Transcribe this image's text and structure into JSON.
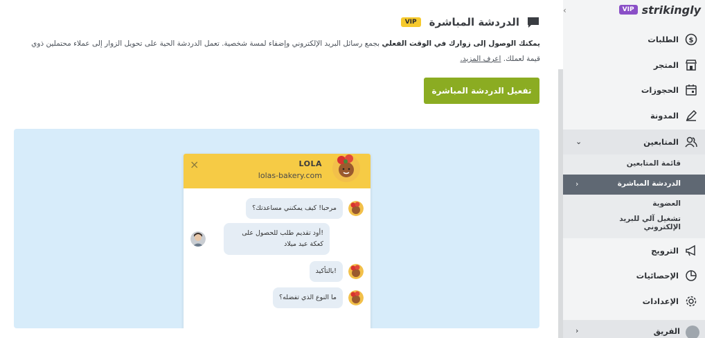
{
  "main": {
    "title": "الدردشة المباشرة",
    "vip_badge": "VIP",
    "description_bold": "يمكنك الوصول إلى زوارك في الوقت الفعلي",
    "description_text": " بجمع رسائل البريد الإلكتروني وإضفاء لمسة شخصية. تعمل الدردشة الحية على تحويل الزوار إلى عملاء محتملين ذوي قيمة لعملك. ",
    "learn_more": "اعرف المزيد.",
    "activate_button": "تفعيل الدردشة المباشرة",
    "widget": {
      "close_symbol": "×",
      "name": "LOLA",
      "site": "lolas-bakery.com",
      "messages": [
        {
          "from": "business",
          "text": "مرحبا! كيف يمكنني مساعدتك؟"
        },
        {
          "from": "visitor",
          "text": "!أود تقديم طلب للحصول على كعكة عيد ميلاد"
        },
        {
          "from": "business",
          "text": "!بالتأكيد"
        },
        {
          "from": "business",
          "text": "ما النوع الذي تفضله؟"
        }
      ]
    }
  },
  "sidebar": {
    "collapse_arrow": "‹",
    "brand_vip": "VIP",
    "brand_logo": "strikingly",
    "items": [
      {
        "label": "الطلبات",
        "icon": "dollar-circle-icon"
      },
      {
        "label": "المتجر",
        "icon": "store-icon"
      },
      {
        "label": "الحجوزات",
        "icon": "calendar-icon"
      },
      {
        "label": "المدونة",
        "icon": "pen-icon"
      },
      {
        "label": "المتابعين",
        "icon": "users-icon",
        "expanded": true
      },
      {
        "label": "الترويج",
        "icon": "megaphone-icon"
      },
      {
        "label": "الإحصائيات",
        "icon": "pie-chart-icon"
      },
      {
        "label": "الإعدادات",
        "icon": "gear-icon"
      }
    ],
    "sub_items": [
      {
        "label": "قائمة المتابعين"
      },
      {
        "label": "الدردشة المباشرة",
        "active": true
      },
      {
        "label": "العضوية"
      },
      {
        "label": "تشغيل آلي للبريد الإلكتروني"
      }
    ],
    "team_label": "الفريق",
    "chevron_down": "⌄",
    "chevron_right": "›"
  },
  "colors": {
    "activate_button": "#8bac22",
    "preview_bg": "#d7ecfa",
    "widget_header": "#f6cb45",
    "active_sub_item": "#5f6873",
    "brand_vip": "#8a4fc7",
    "vip_badge": "#f6c92c"
  }
}
